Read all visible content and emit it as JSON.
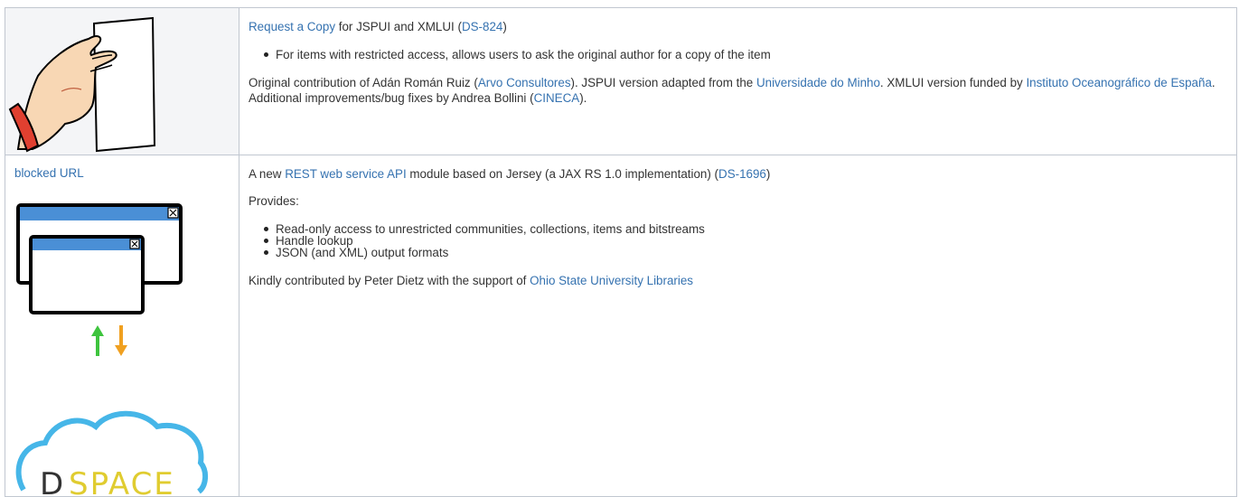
{
  "row1": {
    "heading": {
      "link1": "Request a Copy",
      "mid": " for JSPUI and XMLUI (",
      "link2": "DS-824",
      "end": ")"
    },
    "bullets": [
      "For items with restricted access, allows users to ask the original author for a copy of the item"
    ],
    "contrib": {
      "t1": "Original contribution of Adán Román Ruiz (",
      "l1": "Arvo Consultores",
      "t2": "). JSPUI version adapted from the ",
      "l2": "Universidade do Minho",
      "t3": ". XMLUI version funded by ",
      "l3": "Instituto Oceanográfico de España",
      "t4": ". Additional improvements/bug fixes by Andrea Bollini (",
      "l4": "CINECA",
      "t5": ")."
    }
  },
  "row2": {
    "image_alt_link": "blocked URL",
    "logo_text": "SPACE",
    "logo_d": "D",
    "heading": {
      "t1": "A new ",
      "l1": "REST web service API",
      "t2": " module based on Jersey (a JAX RS 1.0 implementation) (",
      "l2": "DS-1696",
      "t3": ")"
    },
    "provides": "Provides:",
    "bullets": [
      "Read-only access to unrestricted communities, collections, items and bitstreams",
      "Handle lookup",
      "JSON (and XML) output formats"
    ],
    "credit": {
      "t1": "Kindly contributed by Peter Dietz with the support of ",
      "l1": "Ohio State University Libraries"
    }
  },
  "colors": {
    "link": "#3572b0",
    "text": "#333333",
    "border": "#c1c7d0",
    "image_cell_bg": "#f4f5f7",
    "arrow_up": "#3ec43e",
    "arrow_down": "#f0a020",
    "cloud": "#46b6e8",
    "logo_yellow": "#e0cc30"
  }
}
